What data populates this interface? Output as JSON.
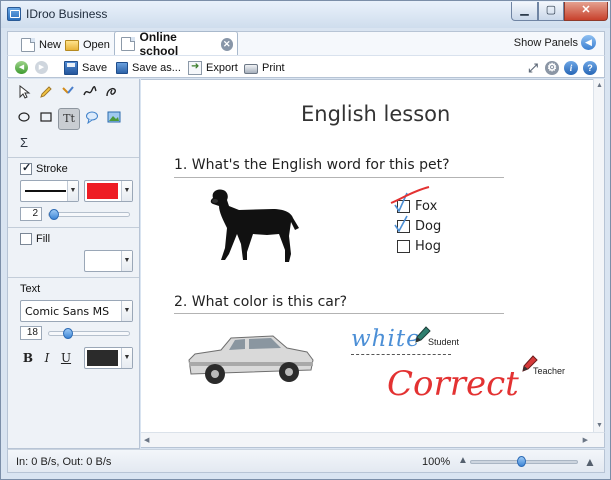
{
  "window": {
    "title": "IDroo Business"
  },
  "tabs": {
    "new_label": "New",
    "open_label": "Open",
    "doc_tab_label": "Online school",
    "show_panels_label": "Show Panels"
  },
  "toolbar": {
    "save_label": "Save",
    "save_as_label": "Save as...",
    "export_label": "Export",
    "print_label": "Print"
  },
  "panel": {
    "stroke_label": "Stroke",
    "stroke_checked": true,
    "stroke_color": "#ee1c24",
    "stroke_width": "2",
    "fill_label": "Fill",
    "fill_checked": false,
    "fill_color": "#ffffff",
    "text_section_label": "Text",
    "font_name": "Comic Sans MS",
    "font_size": "18",
    "text_color": "#2b2b2b",
    "bold_label": "B",
    "italic_label": "I",
    "underline_label": "U"
  },
  "canvas": {
    "title": "English lesson",
    "q1": "1. What's the English word for this pet?",
    "options": [
      {
        "label": "Fox",
        "checked": true,
        "crossed": true
      },
      {
        "label": "Dog",
        "checked": true,
        "crossed": false
      },
      {
        "label": "Hog",
        "checked": false,
        "crossed": false
      }
    ],
    "q2": "2. What color is this car?",
    "student_answer": "white",
    "student_pen_label": "Student",
    "teacher_mark": "Correct",
    "teacher_pen_label": "Teacher"
  },
  "status": {
    "transfer": "In: 0 B/s, Out: 0 B/s",
    "zoom": "100%",
    "zoom_fraction": 0.46
  },
  "colors": {
    "student_ink": "#4c8fd6",
    "teacher_ink": "#e33232",
    "accent": "#3e86d6"
  },
  "icons": {
    "app": "idroo-logo-icon",
    "save": "floppy-icon",
    "export": "export-icon",
    "print": "printer-icon"
  }
}
